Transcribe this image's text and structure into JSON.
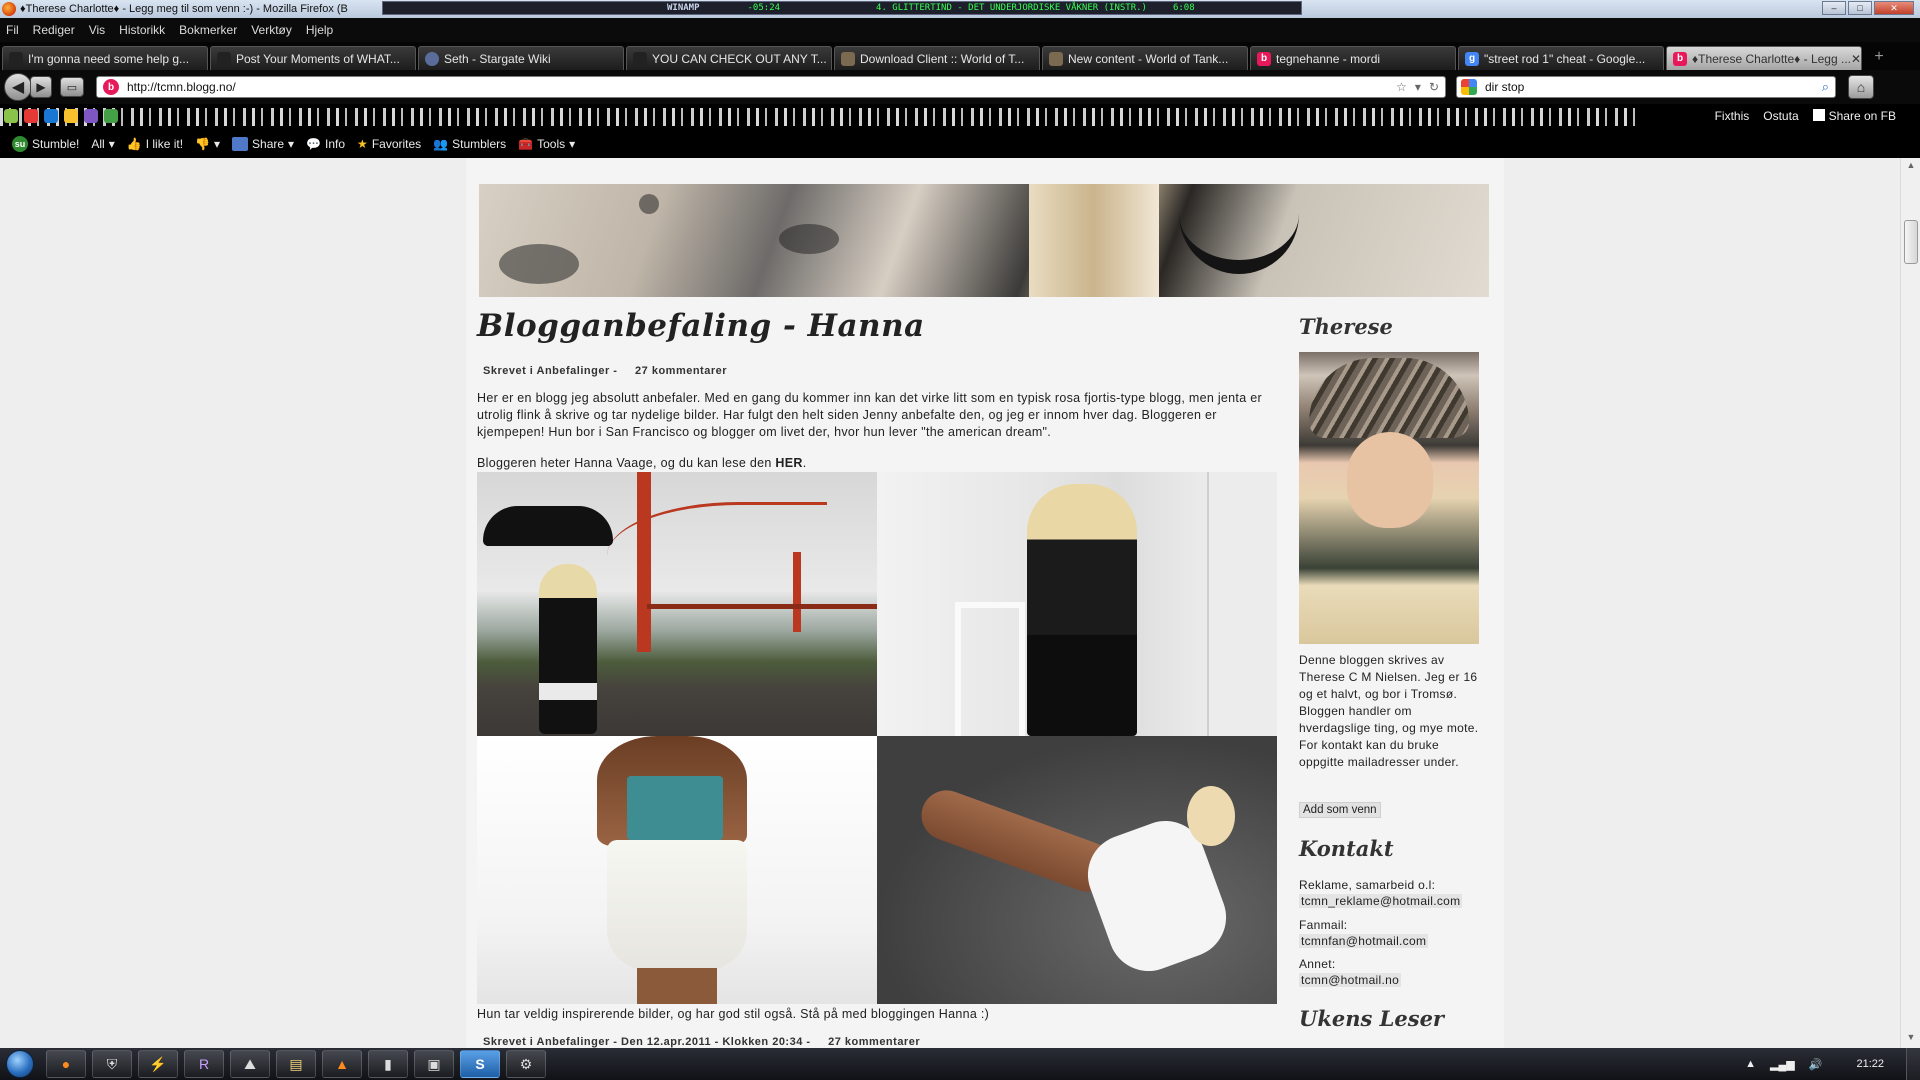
{
  "window": {
    "title": "♦Therese Charlotte♦ - Legg meg til som venn :-) - Mozilla Firefox (B",
    "controls": [
      "–",
      "□",
      "✕"
    ]
  },
  "winamp": {
    "label": "WINAMP",
    "time": "-05:24",
    "song": "4. GLITTERTIND - DET UNDERJORDISKE VÅKNER (INSTR.)",
    "song_time": "6:08"
  },
  "menu": [
    "Fil",
    "Rediger",
    "Vis",
    "Historikk",
    "Bokmerker",
    "Verktøy",
    "Hjelp"
  ],
  "tabs": [
    {
      "label": "I'm gonna need some help g...",
      "icon_color": "#222"
    },
    {
      "label": "Post Your Moments of WHAT...",
      "icon_color": "#222"
    },
    {
      "label": "Seth - Stargate Wiki",
      "icon_color": "#5a6d9a"
    },
    {
      "label": "YOU CAN CHECK OUT ANY T...",
      "icon_color": "#222"
    },
    {
      "label": "Download Client :: World of T...",
      "icon_color": "#7a6a50"
    },
    {
      "label": "New content - World of Tank...",
      "icon_color": "#7a6a50"
    },
    {
      "label": "tegnehanne - mordi",
      "icon_color": "#e8195a"
    },
    {
      "label": "\"street rod 1\" cheat - Google...",
      "icon_color": "#4285f4"
    },
    {
      "label": "♦Therese Charlotte♦ - Legg ...",
      "icon_color": "#e8195a"
    }
  ],
  "nav": {
    "url": "http://tcmn.blogg.no/",
    "search": "dir stop"
  },
  "sharebar": [
    "Fixthis",
    "Ostuta",
    "Share on FB"
  ],
  "stumble": [
    "Stumble!",
    "All",
    "I like it!",
    "Share",
    "Info",
    "Favorites",
    "Stumblers",
    "Tools"
  ],
  "post": {
    "title": "Blogganbefaling - Hanna",
    "meta_category": "Skrevet i Anbefalinger -",
    "meta_comments": "27 kommentarer",
    "body": "Her er en blogg jeg absolutt anbefaler. Med en gang du kommer inn kan det virke litt som en typisk rosa fjortis-type blogg, men jenta er utrolig flink å skrive og tar nydelige bilder. Har fulgt den helt siden Jenny anbefalte den, og jeg er innom hver dag. Bloggeren er kjempepen! Hun bor i San Francisco og blogger om livet der, hvor hun lever \"the american dream\".",
    "line2_pre": "Bloggeren heter Hanna Vaage, og du kan lese den",
    "line2_link": "HER",
    "line2_post": ".",
    "caption": "Hun tar veldig inspirerende bilder, og har god stil også. Stå på med bloggingen Hanna :)",
    "meta2_category": "Skrevet i Anbefalinger - Den 12.apr.2011 - Klokken 20:34 -",
    "meta2_comments": "27 kommentarer"
  },
  "sidebar": {
    "name_heading": "Therese",
    "about": "Denne bloggen skrives av Therese C M Nielsen. Jeg er 16 og et halvt, og bor i Tromsø. Bloggen handler om hverdagslige ting, og mye mote. For kontakt kan du bruke oppgitte mailadresser under.",
    "add_button": "Add som venn",
    "contact_heading": "Kontakt",
    "contacts": [
      {
        "label": "Reklame, samarbeid o.l:",
        "email": "tcmn_reklame@hotmail.com"
      },
      {
        "label": "Fanmail:",
        "email": "tcmnfan@hotmail.com"
      },
      {
        "label": "Annet:",
        "email": "tcmn@hotmail.no"
      }
    ],
    "reader_heading": "Ukens Leser"
  },
  "taskbar": {
    "apps": [
      "firefox",
      "wot",
      "winamp",
      "rift",
      "network",
      "explorer",
      "vlc",
      "notepad",
      "terminal",
      "skype",
      "misc"
    ],
    "clock": "21:22"
  },
  "colors": {
    "page_bg": "#eeeeee",
    "blog_bg": "#f4f4f4",
    "accent_pink": "#e8195a"
  }
}
